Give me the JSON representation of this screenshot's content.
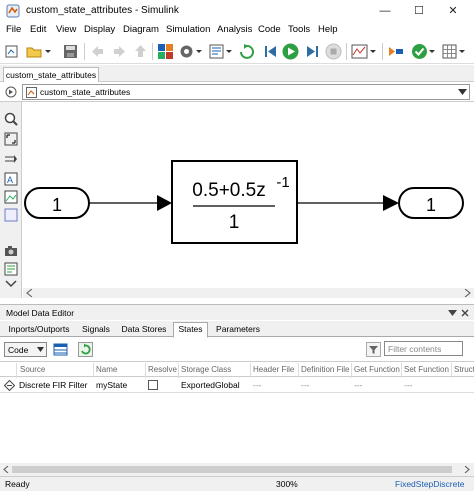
{
  "window": {
    "title": "custom_state_attributes - Simulink",
    "minimize": "—",
    "maximize": "☐",
    "close": "✕"
  },
  "menu": [
    "File",
    "Edit",
    "View",
    "Display",
    "Diagram",
    "Simulation",
    "Analysis",
    "Code",
    "Tools",
    "Help"
  ],
  "model_tab": "custom_state_attributes",
  "breadcrumb": "custom_state_attributes",
  "diagram": {
    "inport_label": "1",
    "outport_label": "1",
    "tf_numerator": "0.5+0.5z",
    "tf_exponent": "-1",
    "tf_denominator": "1"
  },
  "mde": {
    "title": "Model Data Editor",
    "tabs": [
      "Inports/Outports",
      "Signals",
      "Data Stores",
      "States",
      "Parameters"
    ],
    "active_tab": "States",
    "view_select": "Code",
    "filter_placeholder": "Filter contents",
    "columns": [
      "Source",
      "Name",
      "Resolve",
      "Storage Class",
      "Header File",
      "Definition File",
      "Get Function",
      "Set Function",
      "Struct"
    ],
    "row": {
      "source": "Discrete FIR Filter",
      "name": "myState",
      "storage_class": "ExportedGlobal",
      "header_file": "---",
      "definition_file": "---",
      "get_function": "---",
      "set_function": "---"
    }
  },
  "status": {
    "state": "Ready",
    "zoom": "300%",
    "solver": "FixedStepDiscrete"
  },
  "colors": {
    "accent_blue": "#1a5fb4",
    "run_green": "#2ea043"
  }
}
